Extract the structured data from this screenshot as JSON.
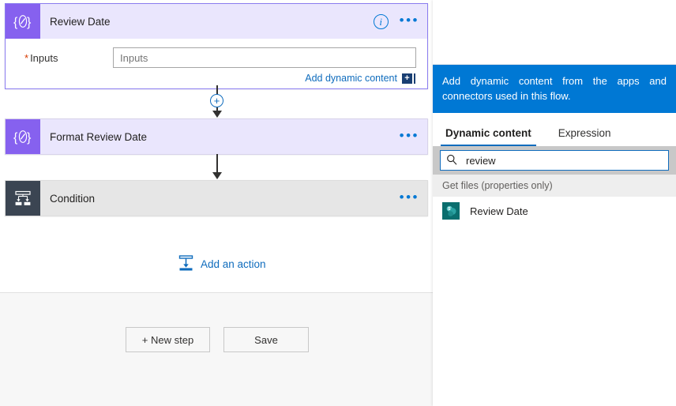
{
  "canvas": {
    "cards": [
      {
        "title": "Review Date",
        "icon": "compose-braces-icon",
        "info_icon": "info-icon",
        "menu_icon": "ellipsis-icon",
        "field_label": "Inputs",
        "required_marker": "*",
        "field_value": "",
        "field_placeholder": "Inputs",
        "dynamic_link": "Add dynamic content",
        "dynamic_plus": "+"
      },
      {
        "title": "Format Review Date",
        "icon": "compose-braces-icon",
        "menu_icon": "ellipsis-icon"
      },
      {
        "title": "Condition",
        "icon": "condition-branch-icon",
        "menu_icon": "ellipsis-icon"
      }
    ],
    "insert_plus": "+",
    "add_action_label": "Add an action",
    "buttons": {
      "new_step": "+ New step",
      "save": "Save"
    }
  },
  "panel": {
    "callout": "Add dynamic content from the apps and connectors used in this flow.",
    "tabs": [
      {
        "label": "Dynamic content",
        "active": true
      },
      {
        "label": "Expression",
        "active": false
      }
    ],
    "search": {
      "value": "review",
      "placeholder": "",
      "icon": "search-icon"
    },
    "group_header": "Get files (properties only)",
    "items": [
      {
        "label": "Review Date",
        "icon": "sharepoint-icon"
      }
    ]
  },
  "colors": {
    "accent_blue": "#0078d4",
    "link_blue": "#0f6cbd",
    "purple_icon": "#8661ef",
    "purple_header": "#eae6fd",
    "condition_icon": "#3b4552",
    "sharepoint_teal": "#0a6e6e",
    "required_red": "#d83b01"
  }
}
